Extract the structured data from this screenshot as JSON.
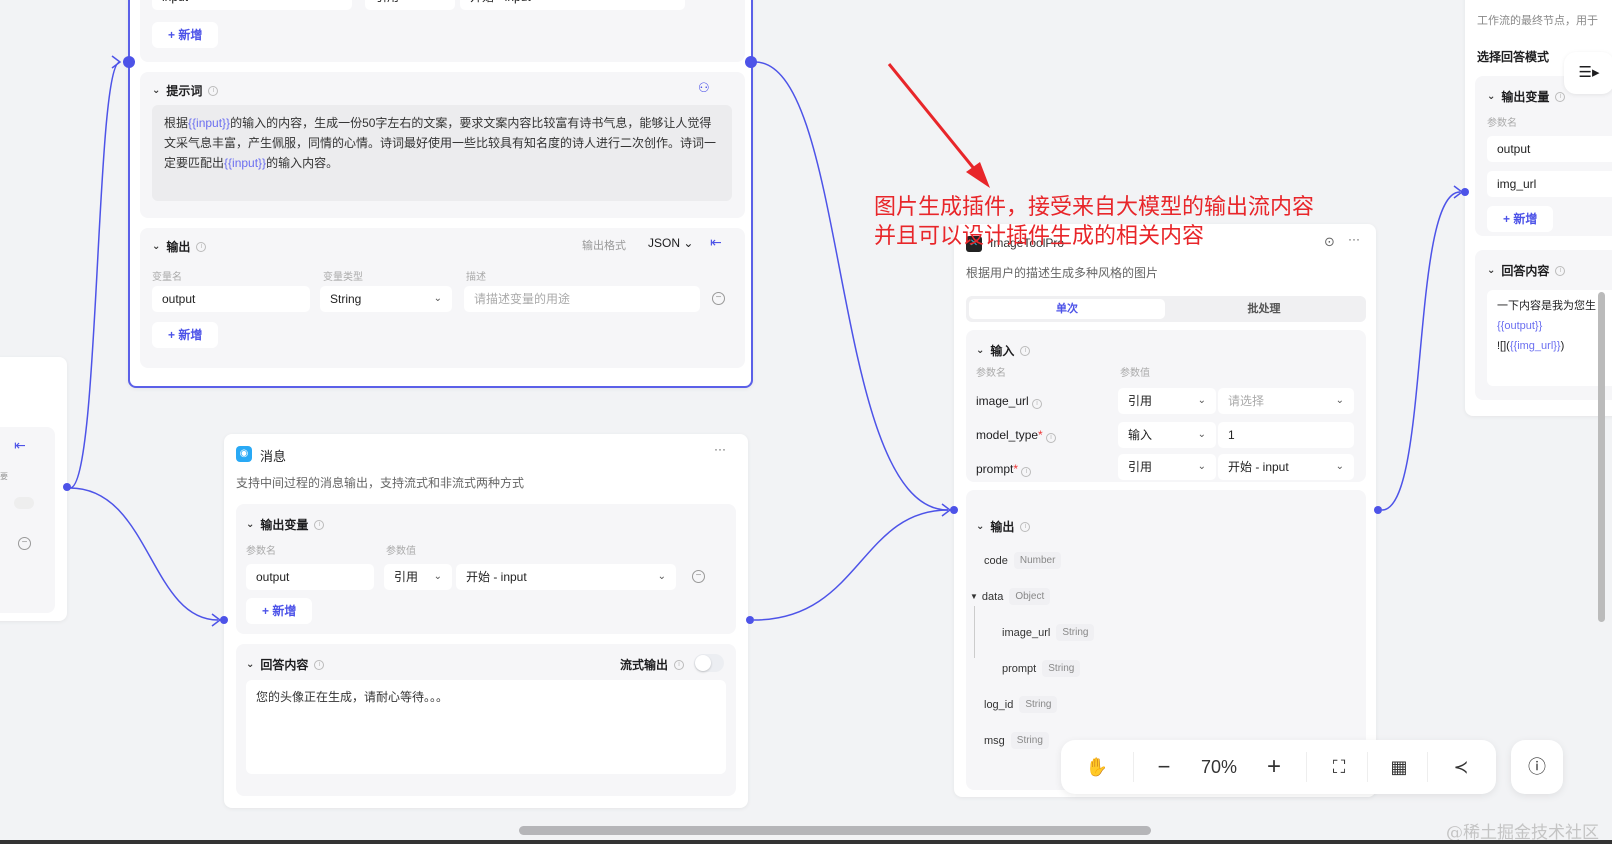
{
  "llm_node": {
    "top_input_name": "input",
    "top_input_type": "引用",
    "top_input_value": "开始 - input",
    "add_label": "新增",
    "prompt": {
      "title": "提示词",
      "text_parts": [
        "根据",
        "{{input}}",
        "的输入的内容，生成一份50字左右的文案，要求文案内容比较富有诗书气息，能够让人觉得文采气息丰富，产生佩服，同情的心情。诗词最好使用一些比较具有知名度的诗人进行二次创作。诗词一定要匹配出",
        "{{input}}",
        "的输入内容。"
      ]
    },
    "output": {
      "title": "输出",
      "format_label": "输出格式",
      "format_value": "JSON",
      "col_name": "变量名",
      "col_type": "变量类型",
      "col_desc": "描述",
      "row_name": "output",
      "row_type": "String",
      "desc_placeholder": "请描述变量的用途",
      "add_label": "新增"
    }
  },
  "left_node": {
    "label_fragment": "要"
  },
  "message_node": {
    "title": "消息",
    "description": "支持中间过程的消息输出，支持流式和非流式两种方式",
    "vars": {
      "title": "输出变量",
      "col_name": "参数名",
      "col_value": "参数值",
      "row_name": "output",
      "row_type": "引用",
      "row_value": "开始 - input",
      "add_label": "新增"
    },
    "answer": {
      "title": "回答内容",
      "stream_label": "流式输出",
      "stream_on": false,
      "text": "您的头像正在生成，请耐心等待。。。"
    }
  },
  "plugin_node": {
    "title": "ImageToolPro",
    "description": "根据用户的描述生成多种风格的图片",
    "tabs": [
      "单次",
      "批处理"
    ],
    "active_tab": 0,
    "input": {
      "title": "输入",
      "col_name": "参数名",
      "col_value": "参数值",
      "rows": [
        {
          "name": "image_url",
          "required": false,
          "type": "引用",
          "value": "请选择",
          "placeholder": true
        },
        {
          "name": "model_type",
          "required": true,
          "type": "输入",
          "value": "1",
          "placeholder": false
        },
        {
          "name": "prompt",
          "required": true,
          "type": "引用",
          "value": "开始 - input",
          "placeholder": false
        }
      ]
    },
    "output": {
      "title": "输出",
      "fields": [
        {
          "name": "code",
          "type": "Number"
        },
        {
          "name": "data",
          "type": "Object"
        },
        {
          "name": "image_url",
          "type": "String"
        },
        {
          "name": "prompt",
          "type": "String"
        },
        {
          "name": "log_id",
          "type": "String"
        },
        {
          "name": "msg",
          "type": "String"
        }
      ]
    }
  },
  "end_node": {
    "description": "工作流的最终节点，用于",
    "mode_label": "选择回答模式",
    "vars": {
      "title": "输出变量",
      "col_name": "参数名",
      "rows": [
        "output",
        "img_url"
      ],
      "add_label": "新增"
    },
    "answer": {
      "title": "回答内容",
      "line1": "一下内容是我为您生",
      "line2": "{{output}}",
      "line3_prefix": "![](",
      "line3_var": "{{img_url}}",
      "line3_suffix": ")"
    }
  },
  "annotation": {
    "line1": "图片生成插件，接受来自大模型的输出流内容",
    "line2": "并且可以设计插件生成的相关内容",
    "color": "#e8262a"
  },
  "toolbar": {
    "zoom": "70%"
  },
  "watermark": "@稀土掘金技术社区",
  "colors": {
    "accent": "#4d53e8"
  }
}
